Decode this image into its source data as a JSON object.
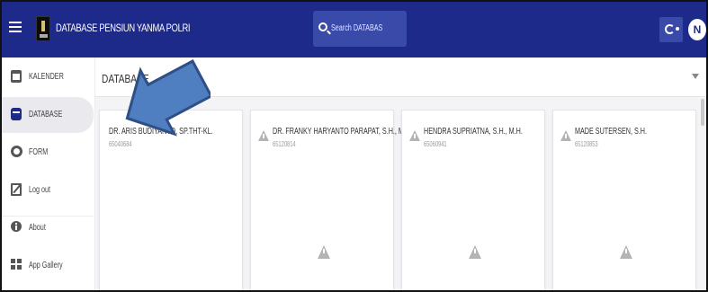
{
  "header": {
    "app_title": "DATABASE PENSIUN YANMA POLRI",
    "search_placeholder": "Search DATABASE",
    "avatar_initial": "N"
  },
  "sidebar": {
    "items": [
      {
        "label": "KALENDER",
        "icon": "calendar-icon",
        "active": false
      },
      {
        "label": "DATABASE",
        "icon": "database-icon",
        "active": true
      },
      {
        "label": "FORM",
        "icon": "form-icon",
        "active": false
      },
      {
        "label": "Log out",
        "icon": "logout-icon",
        "active": false
      },
      {
        "label": "About",
        "icon": "info-icon",
        "active": false
      },
      {
        "label": "App Gallery",
        "icon": "apps-icon",
        "active": false
      }
    ]
  },
  "main": {
    "section_title": "DATABASE",
    "cards": [
      {
        "name": "DR. ARIS BUDIYANTO, SP.THT-KL.",
        "nrp": "65040684"
      },
      {
        "name": "DR. FRANKY HARYANTO PARAPAT, S.H., M.SI.",
        "nrp": "65120814"
      },
      {
        "name": "HENDRA SUPRIATNA, S.H., M.H.",
        "nrp": "65060941"
      },
      {
        "name": "MADE SUTERSEN, S.H.",
        "nrp": "65120853"
      }
    ]
  },
  "colors": {
    "header_bg": "#1e2a8a",
    "search_bg": "#3a4aa8",
    "arrow_fill": "#4f7fc1",
    "arrow_stroke": "#2f4f86"
  }
}
